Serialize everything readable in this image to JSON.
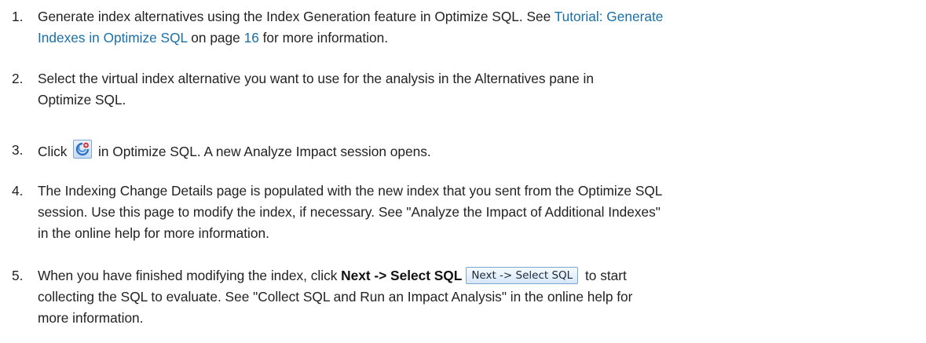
{
  "steps": [
    {
      "num": "1.",
      "pre": "Generate index alternatives using the Index Generation feature in Optimize SQL. See ",
      "link": "Tutorial: Generate",
      "link2": "Indexes in Optimize SQL",
      "mid": " on page ",
      "page_link": "16",
      "post": " for more information."
    },
    {
      "num": "2.",
      "line1": "Select the virtual index alternative you want to use for the analysis in the Alternatives pane in",
      "line2": "Optimize SQL."
    },
    {
      "num": "3.",
      "pre": "Click ",
      "icon": "analyze-impact-icon",
      "post": " in Optimize SQL. A new Analyze Impact session opens."
    },
    {
      "num": "4.",
      "line1": "The Indexing Change Details page is populated with the new index that you sent from the Optimize SQL",
      "line2": "session. Use this page to modify the index, if necessary. See \"Analyze the Impact of Additional Indexes\"",
      "line3": "in the online help for more information."
    },
    {
      "num": "5.",
      "pre": "When you have finished modifying the index, click ",
      "bold": "Next -> Select SQL",
      "button": "Next -> Select SQL",
      "post": " to start",
      "line2": "collecting the SQL to evaluate. See \"Collect SQL and Run an Impact Analysis\" in the online help for",
      "line3": "more information."
    }
  ],
  "colors": {
    "text": "#222222",
    "link": "#1a6fa8"
  }
}
